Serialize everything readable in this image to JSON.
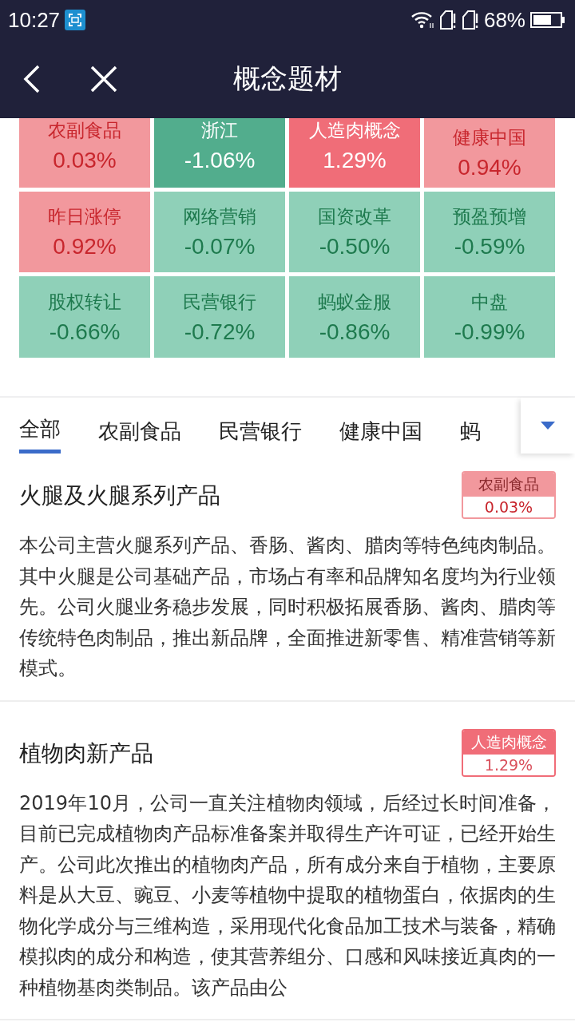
{
  "status_bar": {
    "time": "10:27",
    "battery_text": "68%"
  },
  "nav": {
    "title": "概念题材"
  },
  "tiles": [
    {
      "name": "农副食品",
      "change": "0.03%",
      "kind": "up"
    },
    {
      "name": "浙江",
      "change": "-1.06%",
      "kind": "strong-down"
    },
    {
      "name": "人造肉概念",
      "change": "1.29%",
      "kind": "strong-up"
    },
    {
      "name": "健康中国",
      "change": "0.94%",
      "kind": "up"
    },
    {
      "name": "昨日涨停",
      "change": "0.92%",
      "kind": "up"
    },
    {
      "name": "网络营销",
      "change": "-0.07%",
      "kind": "down"
    },
    {
      "name": "国资改革",
      "change": "-0.50%",
      "kind": "down"
    },
    {
      "name": "预盈预增",
      "change": "-0.59%",
      "kind": "down"
    },
    {
      "name": "股权转让",
      "change": "-0.66%",
      "kind": "down"
    },
    {
      "name": "民营银行",
      "change": "-0.72%",
      "kind": "down"
    },
    {
      "name": "蚂蚁金服",
      "change": "-0.86%",
      "kind": "down"
    },
    {
      "name": "中盘",
      "change": "-0.99%",
      "kind": "down"
    }
  ],
  "tabs": [
    {
      "label": "全部",
      "selected": true
    },
    {
      "label": "农副食品",
      "selected": false
    },
    {
      "label": "民营银行",
      "selected": false
    },
    {
      "label": "健康中国",
      "selected": false
    },
    {
      "label": "蚂",
      "selected": false
    }
  ],
  "articles": [
    {
      "title": "火腿及火腿系列产品",
      "tag": {
        "label": "农副食品",
        "value": "0.03%",
        "kind": "up"
      },
      "body": "本公司主营火腿系列产品、香肠、酱肉、腊肉等特色纯肉制品。其中火腿是公司基础产品，市场占有率和品牌知名度均为行业领先。公司火腿业务稳步发展，同时积极拓展香肠、酱肉、腊肉等传统特色肉制品，推出新品牌，全面推进新零售、精准营销等新模式。"
    },
    {
      "title": "植物肉新产品",
      "tag": {
        "label": "人造肉概念",
        "value": "1.29%",
        "kind": "strong-up"
      },
      "body": "2019年10月，公司一直关注植物肉领域，后经过长时间准备，目前已完成植物肉产品标准备案并取得生产许可证，已经开始生产。公司此次推出的植物肉产品，所有成分来自于植物，主要原料是从大豆、豌豆、小麦等植物中提取的植物蛋白，依据肉的生物化学成分与三维构造，采用现代化食品加工技术与装备，精确模拟肉的成分和构造，使其营养组分、口感和风味接近真肉的一种植物基肉类制品。该产品由公"
    }
  ]
}
